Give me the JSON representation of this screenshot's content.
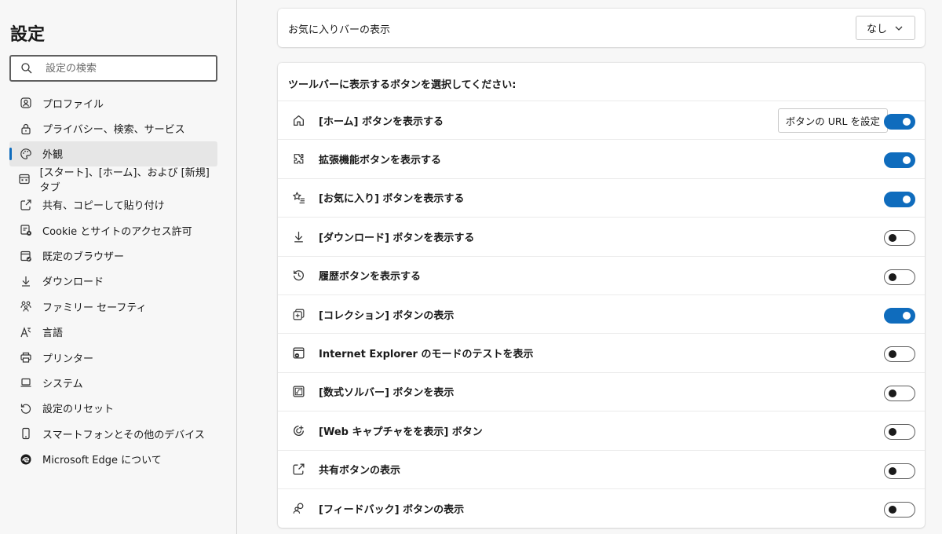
{
  "sidebar": {
    "title": "設定",
    "search": {
      "placeholder": "設定の検索",
      "value": ""
    },
    "items": [
      {
        "label": "プロファイル",
        "icon": "profile-icon",
        "active": false
      },
      {
        "label": "プライバシー、検索、サービス",
        "icon": "lock-icon",
        "active": false
      },
      {
        "label": "外観",
        "icon": "palette-icon",
        "active": true
      },
      {
        "label": "[スタート]、[ホーム]、および [新規] タブ",
        "icon": "tabs-icon",
        "active": false
      },
      {
        "label": "共有、コピーして貼り付け",
        "icon": "share-icon",
        "active": false
      },
      {
        "label": "Cookie とサイトのアクセス許可",
        "icon": "site-permissions-icon",
        "active": false
      },
      {
        "label": "既定のブラウザー",
        "icon": "default-browser-icon",
        "active": false
      },
      {
        "label": "ダウンロード",
        "icon": "download-icon",
        "active": false
      },
      {
        "label": "ファミリー セーフティ",
        "icon": "family-icon",
        "active": false
      },
      {
        "label": "言語",
        "icon": "language-icon",
        "active": false
      },
      {
        "label": "プリンター",
        "icon": "printer-icon",
        "active": false
      },
      {
        "label": "システム",
        "icon": "laptop-icon",
        "active": false
      },
      {
        "label": "設定のリセット",
        "icon": "reset-icon",
        "active": false
      },
      {
        "label": "スマートフォンとその他のデバイス",
        "icon": "phone-icon",
        "active": false
      },
      {
        "label": "Microsoft Edge について",
        "icon": "edge-logo-icon",
        "active": false
      }
    ]
  },
  "favorites_bar": {
    "label": "お気に入りバーの表示",
    "selected": "なし"
  },
  "toolbar": {
    "title": "ツールバーに表示するボタンを選択してください:",
    "url_button_label": "ボタンの URL を設定",
    "rows": [
      {
        "label": "[ホーム] ボタンを表示する",
        "icon": "home-icon",
        "on": true
      },
      {
        "label": "拡張機能ボタンを表示する",
        "icon": "puzzle-icon",
        "on": true
      },
      {
        "label": "[お気に入り] ボタンを表示する",
        "icon": "favorites-icon",
        "on": true
      },
      {
        "label": "[ダウンロード] ボタンを表示する",
        "icon": "download-icon",
        "on": false
      },
      {
        "label": "履歴ボタンを表示する",
        "icon": "history-icon",
        "on": false
      },
      {
        "label": "[コレクション] ボタンの表示",
        "icon": "collections-icon",
        "on": true
      },
      {
        "label": "Internet Explorer のモードのテストを表示",
        "icon": "ie-mode-icon",
        "on": false
      },
      {
        "label": "[数式ソルバー] ボタンを表示",
        "icon": "math-solver-icon",
        "on": false
      },
      {
        "label": "[Web キャプチャをを表示] ボタン",
        "icon": "web-capture-icon",
        "on": false
      },
      {
        "label": "共有ボタンの表示",
        "icon": "share-icon",
        "on": false
      },
      {
        "label": "[フィードバック] ボタンの表示",
        "icon": "feedback-icon",
        "on": false
      }
    ]
  },
  "colors": {
    "accent": "#0f6cbd",
    "background": "#f7f7f7",
    "card": "#ffffff"
  }
}
